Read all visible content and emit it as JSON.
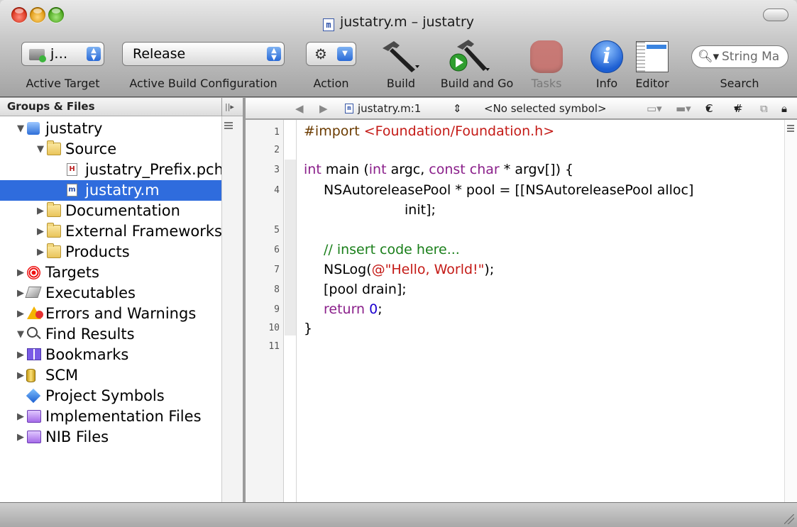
{
  "window": {
    "title": "justatry.m – justatry",
    "file_icon_letter": "m"
  },
  "toolbar": {
    "active_target_value": "j…",
    "build_config_value": "Release",
    "search_placeholder": "String Ma",
    "labels": {
      "active_target": "Active Target",
      "build_config": "Active Build Configuration",
      "action": "Action",
      "build": "Build",
      "build_and_go": "Build and Go",
      "tasks": "Tasks",
      "info": "Info",
      "editor": "Editor",
      "search": "Search"
    },
    "colors": {
      "tasks_stop": "#ca6863",
      "info": "#1d5fd2"
    }
  },
  "sidebar": {
    "header": "Groups & Files",
    "items": [
      {
        "label": "justatry",
        "icon": "project-icon",
        "disclosure": "▼",
        "indent": 0
      },
      {
        "label": "Source",
        "icon": "folder-icon",
        "disclosure": "▼",
        "indent": 1
      },
      {
        "label": "justatry_Prefix.pch",
        "icon": "header-file-icon",
        "disclosure": "",
        "indent": 2
      },
      {
        "label": "justatry.m",
        "icon": "m-file-icon",
        "disclosure": "",
        "indent": 2,
        "selected": true
      },
      {
        "label": "Documentation",
        "icon": "folder-icon",
        "disclosure": "▶",
        "indent": 1
      },
      {
        "label": "External Frameworks",
        "icon": "folder-icon",
        "disclosure": "▶",
        "indent": 1
      },
      {
        "label": "Products",
        "icon": "folder-icon",
        "disclosure": "▶",
        "indent": 1
      },
      {
        "label": "Targets",
        "icon": "target-icon",
        "disclosure": "▶",
        "indent": 0
      },
      {
        "label": "Executables",
        "icon": "executable-icon",
        "disclosure": "▶",
        "indent": 0
      },
      {
        "label": "Errors and Warnings",
        "icon": "warning-icon",
        "disclosure": "▶",
        "indent": 0
      },
      {
        "label": "Find Results",
        "icon": "find-icon",
        "disclosure": "▼",
        "indent": 0
      },
      {
        "label": "Bookmarks",
        "icon": "bookmark-icon",
        "disclosure": "▶",
        "indent": 0
      },
      {
        "label": "SCM",
        "icon": "scm-icon",
        "disclosure": "▶",
        "indent": 0
      },
      {
        "label": "Project Symbols",
        "icon": "symbols-icon",
        "disclosure": "",
        "indent": 0
      },
      {
        "label": "Implementation Files",
        "icon": "implementation-files-icon",
        "disclosure": "▶",
        "indent": 0
      },
      {
        "label": "NIB Files",
        "icon": "nib-files-icon",
        "disclosure": "▶",
        "indent": 0
      }
    ]
  },
  "editor": {
    "nav": {
      "file": "justatry.m:1",
      "symbol": "<No selected symbol>",
      "class_menu": "C",
      "hash_menu": "#"
    },
    "line_numbers": [
      "1",
      "2",
      "3",
      "4",
      "5",
      "6",
      "7",
      "8",
      "9",
      "10",
      "11"
    ],
    "code": {
      "l1_directive": "#import ",
      "l1_path": "<Foundation/Foundation.h>",
      "l3_kw_int": "int",
      "l3_a": " main (",
      "l3_kw_int2": "int",
      "l3_b": " argc, ",
      "l3_kw_const": "const",
      "l3_c": " ",
      "l3_kw_char": "char",
      "l3_d": " * argv[]) {",
      "l4": "NSAutoreleasePool * pool = [[NSAutoreleasePool alloc]",
      "l4_cont": "init];",
      "l6_comment": "// insert code here...",
      "l7_a": "NSLog(",
      "l7_str": "@\"Hello, World!\"",
      "l7_b": ");",
      "l8": "[pool drain];",
      "l9_kw": "return",
      "l9_sp": " ",
      "l9_num": "0",
      "l9_end": ";",
      "l10": "}"
    }
  }
}
